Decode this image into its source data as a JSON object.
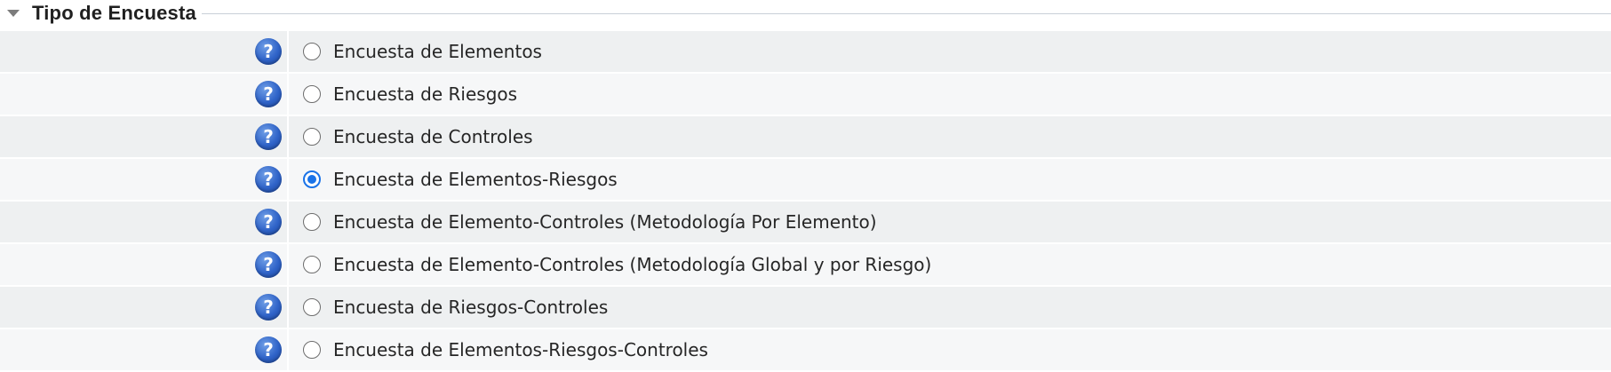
{
  "section": {
    "title": "Tipo de Encuesta",
    "collapse_icon": "triangle-down-icon"
  },
  "help_icon": {
    "glyph": "?",
    "name": "help-icon"
  },
  "accent_color": "#1a73e8",
  "options": [
    {
      "label": "Encuesta de Elementos",
      "checked": false
    },
    {
      "label": "Encuesta de Riesgos",
      "checked": false
    },
    {
      "label": "Encuesta de Controles",
      "checked": false
    },
    {
      "label": "Encuesta de Elementos-Riesgos",
      "checked": true
    },
    {
      "label": "Encuesta de Elemento-Controles (Metodología Por Elemento)",
      "checked": false
    },
    {
      "label": "Encuesta de Elemento-Controles (Metodología Global y por Riesgo)",
      "checked": false
    },
    {
      "label": "Encuesta de Riesgos-Controles",
      "checked": false
    },
    {
      "label": "Encuesta de Elementos-Riesgos-Controles",
      "checked": false
    }
  ]
}
